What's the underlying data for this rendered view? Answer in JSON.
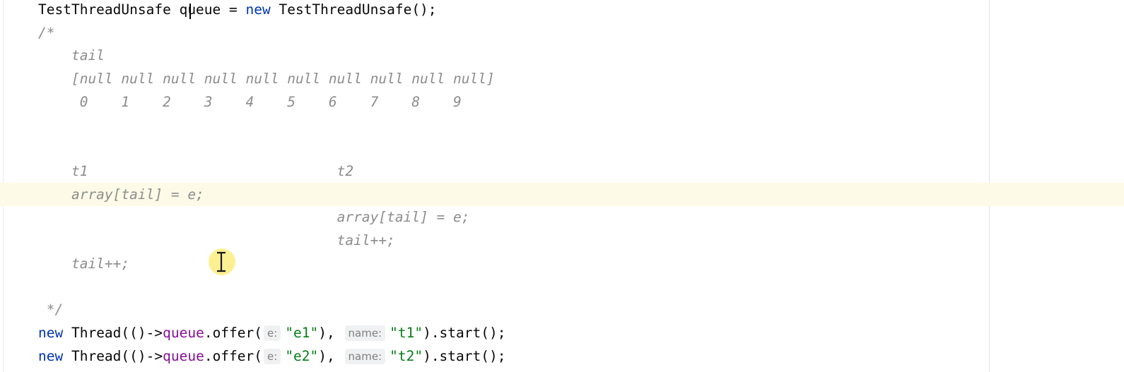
{
  "editor": {
    "lines": [
      {
        "segments": [
          {
            "text": "TestThreadUnsafe queue = ",
            "cls": "plain"
          },
          {
            "text": "new",
            "cls": "kw"
          },
          {
            "text": " TestThreadUnsafe();",
            "cls": "plain"
          }
        ]
      },
      {
        "segments": [
          {
            "text": "/*",
            "cls": "cmt"
          }
        ]
      },
      {
        "segments": [
          {
            "text": "    tail",
            "cls": "cmt"
          }
        ]
      },
      {
        "segments": [
          {
            "text": "    [null null null null null null null null null null]",
            "cls": "cmt"
          }
        ]
      },
      {
        "segments": [
          {
            "text": "     0    1    2    3    4    5    6    7    8    9",
            "cls": "cmt"
          }
        ]
      },
      {
        "segments": []
      },
      {
        "segments": []
      },
      {
        "segments": [
          {
            "text": "    t1                              t2",
            "cls": "cmt"
          }
        ]
      },
      {
        "current": true,
        "segments": [
          {
            "text": "    array[tail] = e;",
            "cls": "cmt"
          }
        ]
      },
      {
        "segments": [
          {
            "text": "                                    array[tail] = e;",
            "cls": "cmt"
          }
        ]
      },
      {
        "segments": [
          {
            "text": "                                    tail++;",
            "cls": "cmt"
          }
        ]
      },
      {
        "segments": [
          {
            "text": "    tail++;",
            "cls": "cmt"
          }
        ]
      },
      {
        "segments": []
      },
      {
        "segments": [
          {
            "text": " */",
            "cls": "cmt"
          }
        ]
      },
      {
        "segments": [
          {
            "text": "new",
            "cls": "kw"
          },
          {
            "text": " Thread(()->",
            "cls": "plain"
          },
          {
            "text": "queue",
            "cls": "field"
          },
          {
            "text": ".offer(",
            "cls": "plain"
          },
          {
            "hint": "e:"
          },
          {
            "text": "\"e1\"",
            "cls": "str"
          },
          {
            "text": "), ",
            "cls": "plain"
          },
          {
            "hint": "name:"
          },
          {
            "text": "\"t1\"",
            "cls": "str"
          },
          {
            "text": ").start();",
            "cls": "plain"
          }
        ]
      },
      {
        "segments": [
          {
            "text": "new",
            "cls": "kw"
          },
          {
            "text": " Thread(()->",
            "cls": "plain"
          },
          {
            "text": "queue",
            "cls": "field"
          },
          {
            "text": ".offer(",
            "cls": "plain"
          },
          {
            "hint": "e:"
          },
          {
            "text": "\"e2\"",
            "cls": "str"
          },
          {
            "text": "), ",
            "cls": "plain"
          },
          {
            "hint": "name:"
          },
          {
            "text": "\"t2\"",
            "cls": "str"
          },
          {
            "text": ").start();",
            "cls": "plain"
          }
        ]
      }
    ],
    "caret_line": 8,
    "colors": {
      "keyword": "#0033b3",
      "comment": "#8c8c8c",
      "string": "#067d17",
      "field": "#871094",
      "current_line": "#fdfbe8",
      "hint_bg": "#f0f1f3"
    }
  }
}
